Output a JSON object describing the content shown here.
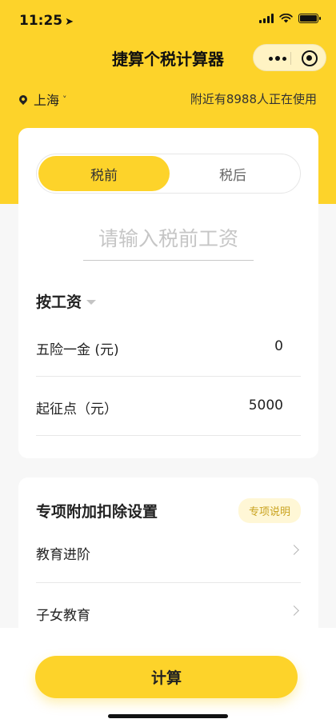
{
  "status_bar": {
    "time": "11:25",
    "location_arrow": "➤"
  },
  "header": {
    "title": "捷算个税计算器"
  },
  "location": {
    "city": "上海",
    "chevron": "˅",
    "users_online": "附近有8988人正在使用"
  },
  "tabs": [
    {
      "label": "税前",
      "active": true
    },
    {
      "label": "税后",
      "active": false
    }
  ],
  "salary_input": {
    "value": "",
    "placeholder": "请输入税前工资"
  },
  "mode": {
    "label": "按工资"
  },
  "rows": {
    "insurance": {
      "label": "五险一金 (元)",
      "value": "0"
    },
    "threshold": {
      "label": "起征点（元）",
      "value": "5000"
    }
  },
  "deductions": {
    "title": "专项附加扣除设置",
    "explain_label": "专项说明",
    "items": [
      {
        "label": "教育进阶"
      },
      {
        "label": "子女教育"
      }
    ]
  },
  "actions": {
    "calculate_label": "计算"
  },
  "colors": {
    "accent": "#fdd32a",
    "badge_bg": "#fff7d6",
    "badge_text": "#c9a21e"
  }
}
